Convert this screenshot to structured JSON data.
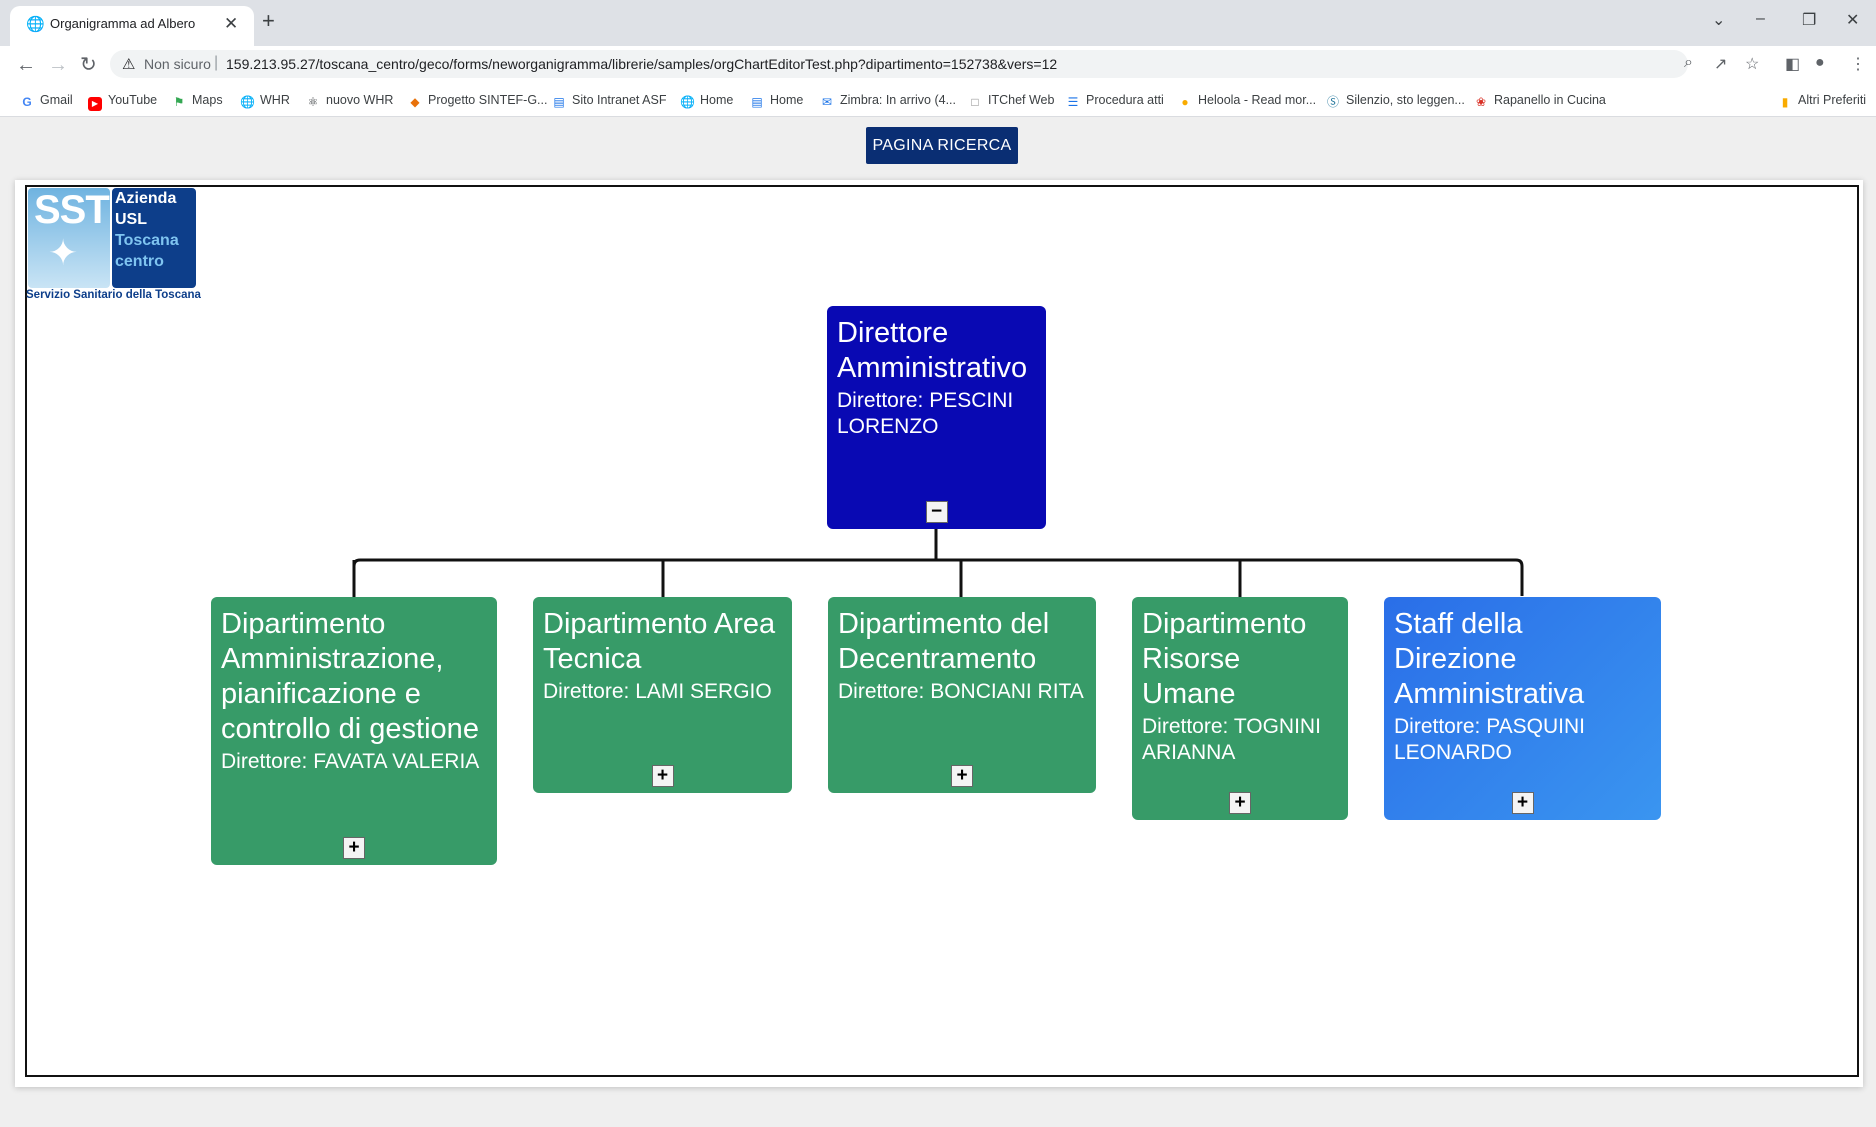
{
  "browser": {
    "tab_title": "Organigramma ad Albero",
    "security_label": "Non sicuro",
    "url": "159.213.95.27/toscana_centro/geco/forms/neworganigramma/librerie/samples/orgChartEditorTest.php?dipartimento=152738&vers=12",
    "bookmarks": [
      "Gmail",
      "YouTube",
      "Maps",
      "WHR",
      "nuovo WHR",
      "Progetto SINTEF-G...",
      "Sito Intranet ASF",
      "Home",
      "Home",
      "Zimbra: In arrivo (4...",
      "ITChef Web",
      "Procedura atti",
      "Heloola - Read mor...",
      "Silenzio, sto leggen...",
      "Rapanello in Cucina"
    ],
    "other_bookmarks": "Altri Preferiti"
  },
  "page": {
    "search_button": "PAGINA RICERCA"
  },
  "logo": {
    "mark": "SST",
    "lines": [
      "Azienda",
      "USL",
      "Toscana",
      "centro"
    ],
    "footer": "Servizio Sanitario della Toscana"
  },
  "org": {
    "root": {
      "title": "Direttore Amministrativo",
      "director": "Direttore: PESCINI LORENZO",
      "toggle": "−"
    },
    "children": [
      {
        "title": "Dipartimento Amministrazione, pianificazione e controllo di gestione",
        "director": "Direttore: FAVATA VALERIA",
        "toggle": "+",
        "color": "#379b68"
      },
      {
        "title": "Dipartimento Area Tecnica",
        "director": "Direttore: LAMI SERGIO",
        "toggle": "+",
        "color": "#379b68"
      },
      {
        "title": "Dipartimento del Decentramento",
        "director": "Direttore: BONCIANI RITA",
        "toggle": "+",
        "color": "#379b68"
      },
      {
        "title": "Dipartimento Risorse Umane",
        "director": "Direttore: TOGNINI ARIANNA",
        "toggle": "+",
        "color": "#379b68"
      },
      {
        "title": "Staff della Direzione Amministrativa",
        "director": "Direttore: PASQUINI LEONARDO",
        "toggle": "+",
        "color": "#2e80ec"
      }
    ]
  }
}
